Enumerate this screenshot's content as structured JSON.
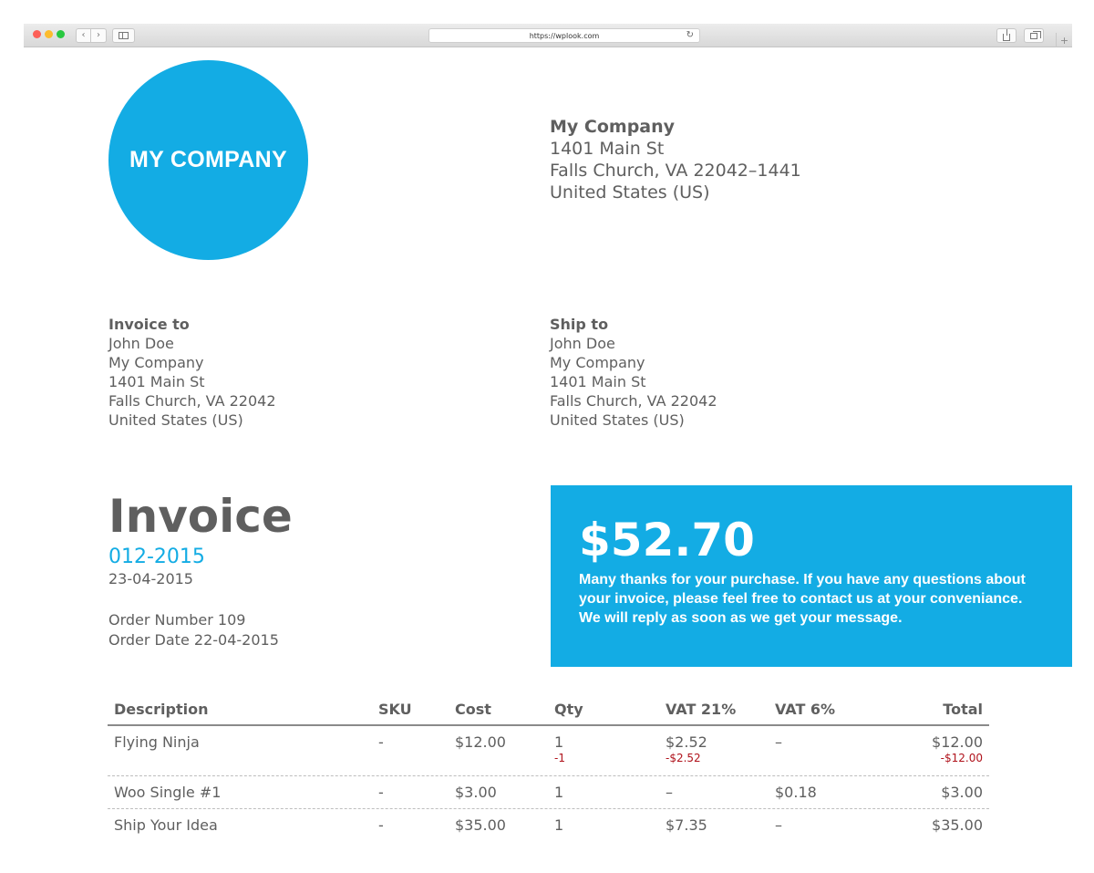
{
  "browser": {
    "url": "https://wplook.com",
    "back_label": "‹",
    "forward_label": "›",
    "reload_label": "↻",
    "plus_label": "+"
  },
  "colors": {
    "accent": "#13ace4",
    "text": "#5f5f5f",
    "negative": "#b0131c"
  },
  "logo": {
    "text": "MY COMPANY"
  },
  "company": {
    "name": "My Company",
    "street": "1401 Main St",
    "city": "Falls Church, VA 22042–1441",
    "country": "United States (US)"
  },
  "invoice_to": {
    "heading": "Invoice to",
    "name": "John Doe",
    "company": "My Company",
    "street": "1401 Main St",
    "city": "Falls Church, VA 22042",
    "country": "United States (US)"
  },
  "ship_to": {
    "heading": "Ship to",
    "name": "John Doe",
    "company": "My Company",
    "street": "1401 Main St",
    "city": "Falls Church, VA 22042",
    "country": "United States (US)"
  },
  "invoice": {
    "title": "Invoice",
    "number": "012-2015",
    "date": "23-04-2015",
    "order_number": "Order Number 109",
    "order_date": "Order Date 22-04-2015"
  },
  "summary": {
    "total": "$52.70",
    "thanks_line_1": "Many thanks for your purchase. If you have any questions about",
    "thanks_line_2": "your invoice, please feel free to contact us at your conveniance.",
    "thanks_line_3": "We will reply as soon as we get your message."
  },
  "table": {
    "headers": {
      "description": "Description",
      "sku": "SKU",
      "cost": "Cost",
      "qty": "Qty",
      "vat21": "VAT 21%",
      "vat6": "VAT 6%",
      "total": "Total"
    },
    "rows": [
      {
        "description": "Flying Ninja",
        "sku": "-",
        "cost": "$12.00",
        "qty": "1",
        "qty_refund": "-1",
        "vat21": "$2.52",
        "vat21_refund": "-$2.52",
        "vat6": "–",
        "total": "$12.00",
        "total_refund": "-$12.00"
      },
      {
        "description": "Woo Single #1",
        "sku": "-",
        "cost": "$3.00",
        "qty": "1",
        "vat21": "–",
        "vat6": "$0.18",
        "total": "$3.00"
      },
      {
        "description": "Ship Your Idea",
        "sku": "-",
        "cost": "$35.00",
        "qty": "1",
        "vat21": "$7.35",
        "vat6": "–",
        "total": "$35.00"
      }
    ]
  }
}
